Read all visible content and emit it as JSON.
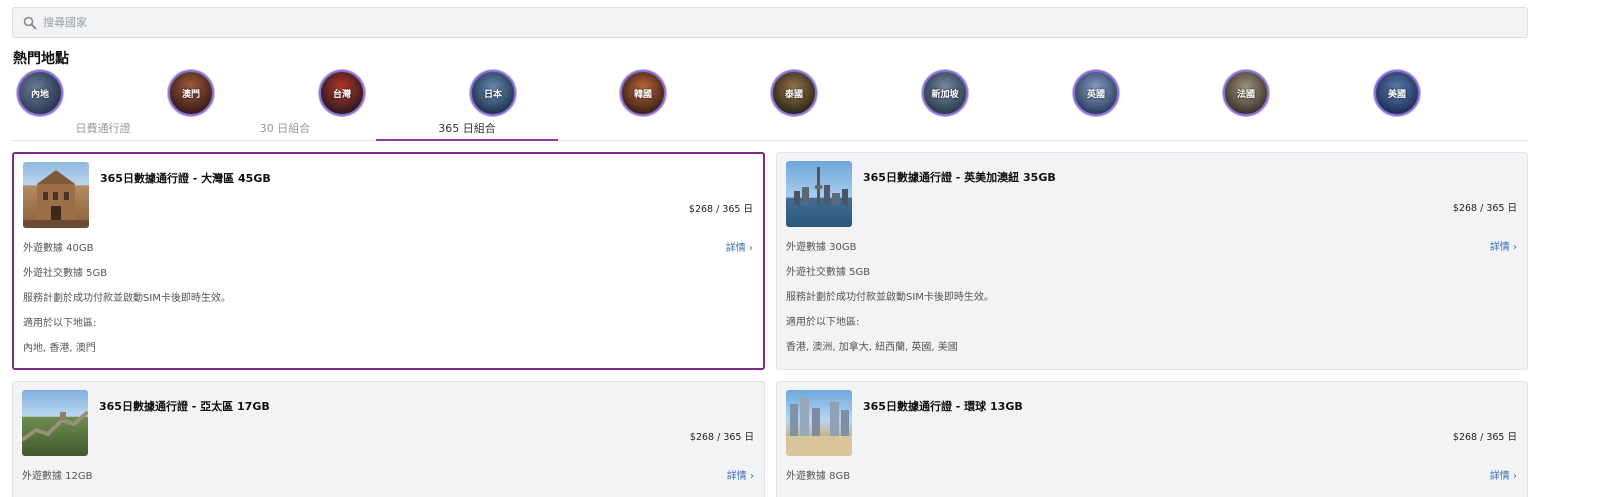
{
  "search": {
    "placeholder": "搜尋國家",
    "icon": "search-icon"
  },
  "section_title": "熱門地點",
  "destinations": [
    "內地",
    "澳門",
    "台灣",
    "日本",
    "韓國",
    "泰國",
    "新加坡",
    "英國",
    "法國",
    "美國"
  ],
  "tabs": [
    "日費通行證",
    "30 日組合",
    "365 日組合"
  ],
  "active_tab": "365 日組合",
  "cards": [
    {
      "title": "365日數據通行證 - 大灣區 45GB",
      "price": "$268 / 365 日",
      "details": "詳情",
      "lines": [
        "外遊數據 40GB",
        "外遊社交數據 5GB",
        "服務計劃於成功付款並啟動SIM卡後即時生效。",
        "適用於以下地區:",
        "內地, 香港, 澳門"
      ]
    },
    {
      "title": "365日數據通行證 - 英美加澳紐 35GB",
      "price": "$268 / 365 日",
      "details": "詳情",
      "lines": [
        "外遊數據 30GB",
        "外遊社交數據 5GB",
        "服務計劃於成功付款並啟動SIM卡後即時生效。",
        "適用於以下地區:",
        "香港, 澳洲, 加拿大, 紐西蘭, 英國, 美國"
      ]
    },
    {
      "title": "365日數據通行證 - 亞太區 17GB",
      "price": "$268 / 365 日",
      "details": "詳情",
      "lines": [
        "外遊數據 12GB"
      ]
    },
    {
      "title": "365日數據通行證 - 環球 13GB",
      "price": "$268 / 365 日",
      "details": "詳情",
      "lines": [
        "外遊數據 8GB"
      ]
    }
  ],
  "colors": {
    "accent": "#7b2b86",
    "link": "#3b6fb6",
    "annotation_arrow": "#e53935"
  }
}
